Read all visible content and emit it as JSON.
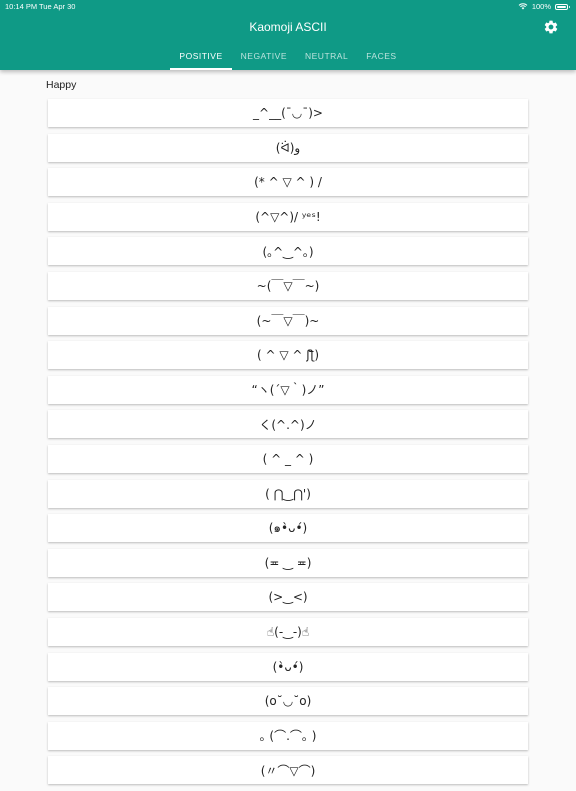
{
  "status_bar": {
    "time": "10:14 PM",
    "date": "Tue Apr 30",
    "battery": "100%",
    "battery_level": 1.0
  },
  "app": {
    "title": "Kaomoji ASCII",
    "accent": "#0f9a86"
  },
  "tabs": [
    {
      "label": "POSITIVE",
      "active": true
    },
    {
      "label": "NEGATIVE",
      "active": false
    },
    {
      "label": "NEUTRAL",
      "active": false
    },
    {
      "label": "FACES",
      "active": false
    }
  ],
  "section": {
    "title": "Happy"
  },
  "kaomoji": [
    "_^__(ˉ◡ˉ)>",
    "(ᐛ)و",
    "(* ^ ▽ ^ ) /",
    "(^▽^)/ ʸᵉˢ!",
    "(｡^‿^｡)",
    "~(￣▽￣~)",
    "(~￣▽￣)~",
    "( ^ ▽ ^ ʃƪ)",
    "“ヽ(´▽｀)ノ”",
    "く(^.^)ノ",
    "( ^ _ ^ )",
    "( ⋂‿⋂')",
    "(๑•̀ᴗ•́)",
    "(≖ ‿ ≖)",
    "(>‿<)",
    "☝(-‿-)☝",
    "(•̀ᴗ•́)",
    "(o˘◡˘o)",
    "｡ (⌒.⌒｡ )",
    "(〃⌒▽⌒)"
  ]
}
